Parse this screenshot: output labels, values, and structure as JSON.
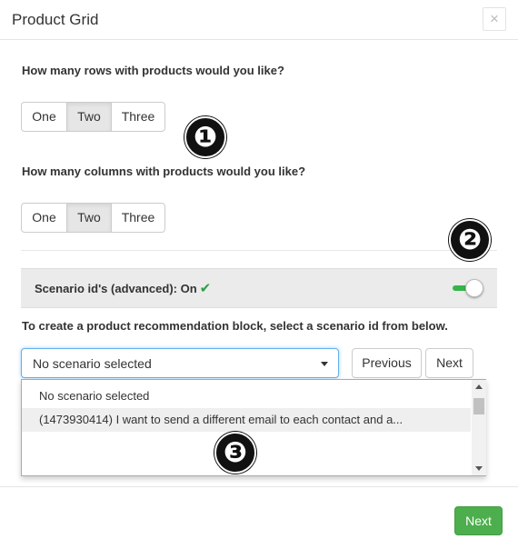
{
  "modal": {
    "title": "Product Grid",
    "close_label": "×"
  },
  "rows_question": {
    "label": "How many rows with products would you like?",
    "options": [
      "One",
      "Two",
      "Three"
    ],
    "selected": "Two"
  },
  "columns_question": {
    "label": "How many columns with products would you like?",
    "options": [
      "One",
      "Two",
      "Three"
    ],
    "selected": "Two"
  },
  "scenario": {
    "label": "Scenario id's (advanced): On",
    "check_icon": "✔",
    "toggle_on": true
  },
  "instruction": "To create a product recommendation block, select a scenario id from below.",
  "scenario_select": {
    "value": "No scenario selected",
    "options": [
      "No scenario selected",
      "(1473930414) I want to send a different email to each contact and a..."
    ]
  },
  "buttons": {
    "previous": "Previous",
    "next": "Next",
    "footer_next": "Next"
  },
  "callouts": [
    "❶",
    "❷",
    "❸"
  ],
  "colors": {
    "accent_green": "#4cae4c",
    "check_green": "#2e9e4a",
    "focus_blue": "#66afe9"
  }
}
